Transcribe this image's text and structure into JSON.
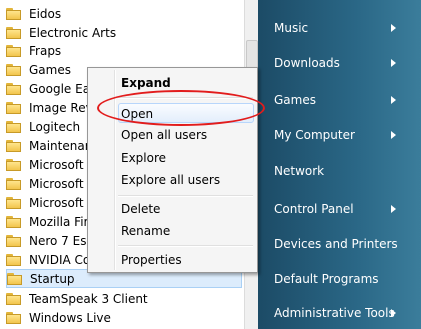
{
  "programs": [
    {
      "label": "Eidos"
    },
    {
      "label": "Electronic Arts"
    },
    {
      "label": "Fraps"
    },
    {
      "label": "Games"
    },
    {
      "label": "Google Ea"
    },
    {
      "label": "Image Rev"
    },
    {
      "label": "Logitech"
    },
    {
      "label": "Maintenar"
    },
    {
      "label": "Microsoft"
    },
    {
      "label": "Microsoft"
    },
    {
      "label": "Microsoft"
    },
    {
      "label": "Mozilla Fir"
    },
    {
      "label": "Nero 7 Ess"
    },
    {
      "label": "NVIDIA Co"
    },
    {
      "label": "Startup"
    },
    {
      "label": "TeamSpeak 3 Client"
    },
    {
      "label": "Windows Live"
    }
  ],
  "selected_program": "Startup",
  "context_menu": {
    "items": [
      {
        "label": "Expand",
        "bold": true
      },
      {
        "label": "Open"
      },
      {
        "label": "Open all users"
      },
      {
        "label": "Explore"
      },
      {
        "label": "Explore all users"
      },
      {
        "label": "Delete"
      },
      {
        "label": "Rename"
      },
      {
        "label": "Properties"
      }
    ],
    "highlighted": "Open"
  },
  "right_menu": [
    {
      "label": "Music",
      "submenu": true
    },
    {
      "label": "Downloads",
      "submenu": true
    },
    {
      "label": "Games",
      "submenu": true
    },
    {
      "label": "My Computer",
      "submenu": true
    },
    {
      "label": "Network",
      "submenu": false
    },
    {
      "label": "Control Panel",
      "submenu": true
    },
    {
      "label": "Devices and Printers",
      "submenu": false
    },
    {
      "label": "Default Programs",
      "submenu": false
    },
    {
      "label": "Administrative Tools",
      "submenu": true
    }
  ],
  "colors": {
    "annotation_circle": "#e21c1c",
    "right_pane": "#2a6786"
  }
}
